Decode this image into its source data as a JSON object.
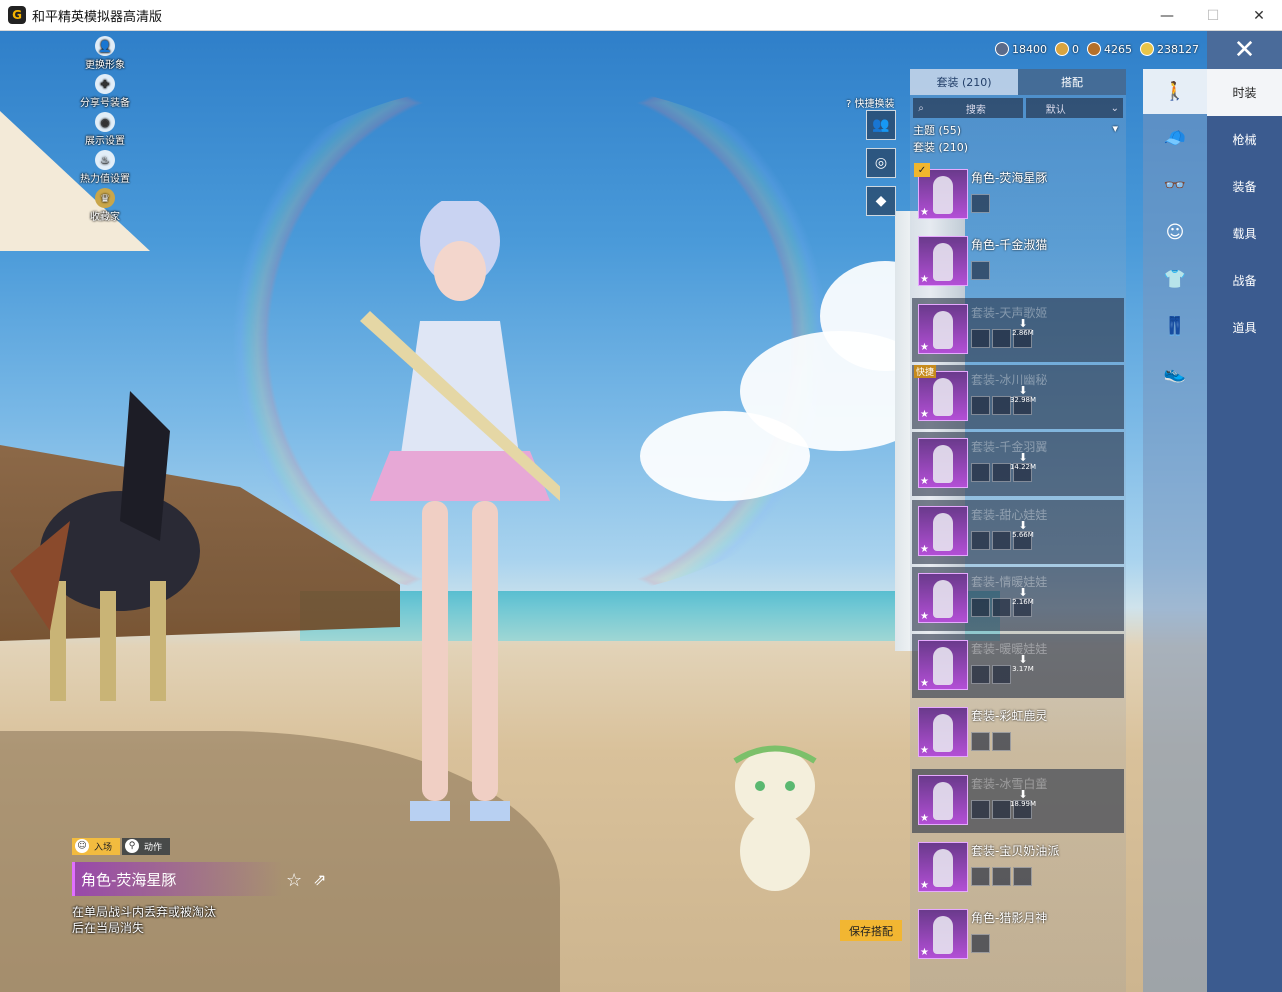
{
  "window": {
    "title": "和平精英模拟器高清版",
    "icon_letter": "G",
    "minimize": "—",
    "maximize": "☐",
    "close": "✕"
  },
  "left_menu": [
    {
      "label": "更换形象",
      "icon": "person-swap-icon",
      "glyph": "👤"
    },
    {
      "label": "分享号装备",
      "icon": "share-gear-icon",
      "glyph": "✚"
    },
    {
      "label": "展示设置",
      "icon": "eye-icon",
      "glyph": "◉"
    },
    {
      "label": "热力值设置",
      "icon": "flame-icon",
      "glyph": "♨"
    },
    {
      "label": "收藏家",
      "icon": "collector-icon",
      "glyph": "♛"
    }
  ],
  "currency": [
    {
      "icon": "silver-coin-icon",
      "color": "#5b6b8a",
      "value": "18400"
    },
    {
      "icon": "gold-g-coin-icon",
      "color": "#d8a440",
      "value": "0"
    },
    {
      "icon": "bronze-coin-icon",
      "color": "#b4702a",
      "value": "4265"
    },
    {
      "icon": "gold-coin-icon",
      "color": "#e8c54a",
      "value": "238127"
    }
  ],
  "quick_change": {
    "label": "快捷换装",
    "slots": [
      "👥",
      "◎",
      "◆"
    ]
  },
  "list": {
    "tabs": [
      {
        "label": "套装 (210)",
        "active": true
      },
      {
        "label": "搭配",
        "active": false
      }
    ],
    "search_placeholder": "搜索",
    "sort_label": "默认",
    "theme_filter": "主题 (55)",
    "suit_filter": "套装 (210)",
    "items": [
      {
        "name": "角色-荧海星豚",
        "dim": false,
        "checked": true,
        "quick": false,
        "size": "",
        "parts": 1
      },
      {
        "name": "角色-千金淑猫",
        "dim": false,
        "checked": false,
        "quick": false,
        "size": "",
        "parts": 1
      },
      {
        "name": "套装-天声歌姬",
        "dim": true,
        "checked": false,
        "quick": false,
        "size": "2.86M",
        "parts": 3
      },
      {
        "name": "套装-冰川幽秘",
        "dim": true,
        "checked": false,
        "quick": true,
        "size": "32.98M",
        "parts": 3
      },
      {
        "name": "套装-千金羽翼",
        "dim": true,
        "checked": false,
        "quick": false,
        "size": "14.22M",
        "parts": 3
      },
      {
        "name": "套装-甜心娃娃",
        "dim": true,
        "checked": false,
        "quick": false,
        "size": "5.66M",
        "parts": 3
      },
      {
        "name": "套装-情暖娃娃",
        "dim": true,
        "checked": false,
        "quick": false,
        "size": "2.16M",
        "parts": 3
      },
      {
        "name": "套装-暖暖娃娃",
        "dim": true,
        "checked": false,
        "quick": false,
        "size": "3.17M",
        "parts": 2
      },
      {
        "name": "套装-彩虹鹿灵",
        "dim": false,
        "checked": false,
        "quick": false,
        "size": "",
        "parts": 2
      },
      {
        "name": "套装-冰雪白童",
        "dim": true,
        "checked": false,
        "quick": false,
        "size": "18.99M",
        "parts": 3
      },
      {
        "name": "套装-宝贝奶油派",
        "dim": false,
        "checked": false,
        "quick": false,
        "size": "",
        "parts": 3
      },
      {
        "name": "角色-猎影月神",
        "dim": false,
        "checked": false,
        "quick": false,
        "size": "",
        "parts": 1
      }
    ]
  },
  "category_icons": [
    "figure-icon",
    "cap-icon",
    "goggles-icon",
    "face-icon",
    "outfit-icon",
    "pants-icon",
    "shoes-icon"
  ],
  "category_glyphs": [
    "🚶",
    "🧢",
    "👓",
    "☺",
    "👕",
    "👖",
    "👟"
  ],
  "side_tabs": [
    {
      "label": "时装",
      "active": true
    },
    {
      "label": "枪械",
      "active": false
    },
    {
      "label": "装备",
      "active": false
    },
    {
      "label": "载具",
      "active": false
    },
    {
      "label": "战备",
      "active": false
    },
    {
      "label": "道具",
      "active": false
    }
  ],
  "close_glyph": "✕",
  "mode_tabs": [
    {
      "label": "入场",
      "active": true
    },
    {
      "label": "动作",
      "active": false
    }
  ],
  "character": {
    "name": "角色-荧海星豚",
    "description": "在单局战斗内丢弃或被淘汰后在当局消失"
  },
  "save_button": "保存搭配",
  "colors": {
    "accent_gold": "#f2b632",
    "panel_blue": "#3b5b8f",
    "rarity_purple": "#b34fd6"
  }
}
